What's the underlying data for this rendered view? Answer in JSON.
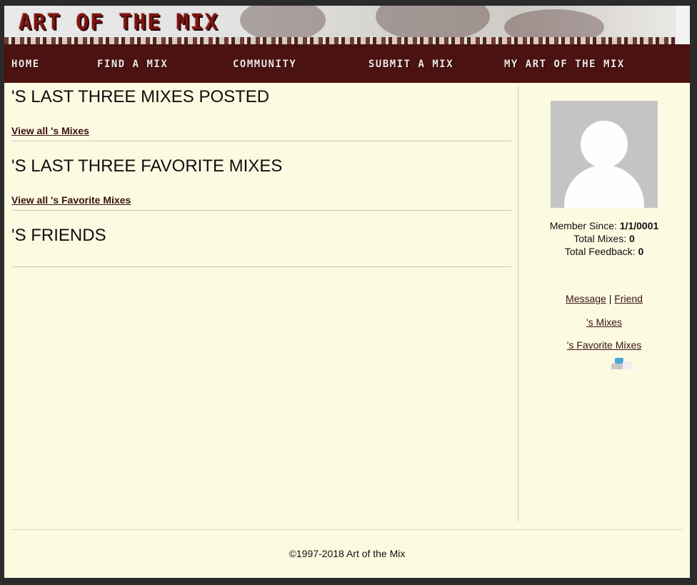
{
  "site": {
    "logo": "ART OF THE MIX"
  },
  "nav": {
    "items": [
      {
        "label": "Home"
      },
      {
        "label": "Find a Mix"
      },
      {
        "label": "Community"
      },
      {
        "label": "Submit a Mix"
      },
      {
        "label": "My Art of the Mix"
      }
    ]
  },
  "main": {
    "sections": [
      {
        "heading": "'S LAST THREE MIXES POSTED",
        "link": "View all 's Mixes"
      },
      {
        "heading": "'S LAST THREE FAVORITE MIXES",
        "link": "View all 's Favorite Mixes"
      },
      {
        "heading": "'S FRIENDS"
      }
    ]
  },
  "profile": {
    "member_since_label": "Member Since:",
    "member_since_value": "1/1/0001",
    "total_mixes_label": "Total Mixes:",
    "total_mixes_value": "0",
    "total_feedback_label": "Total Feedback:",
    "total_feedback_value": "0",
    "message_link": "Message",
    "separator": "|",
    "friend_link": "Friend",
    "mixes_link": "'s Mixes",
    "favorite_mixes_link": "'s Favorite Mixes"
  },
  "footer": {
    "copyright": "©1997-2018 Art of the Mix"
  },
  "colors": {
    "nav_bg": "#4a1210",
    "page_bg": "#fcfbe2",
    "link": "#3a1210",
    "logo": "#7a1410"
  }
}
